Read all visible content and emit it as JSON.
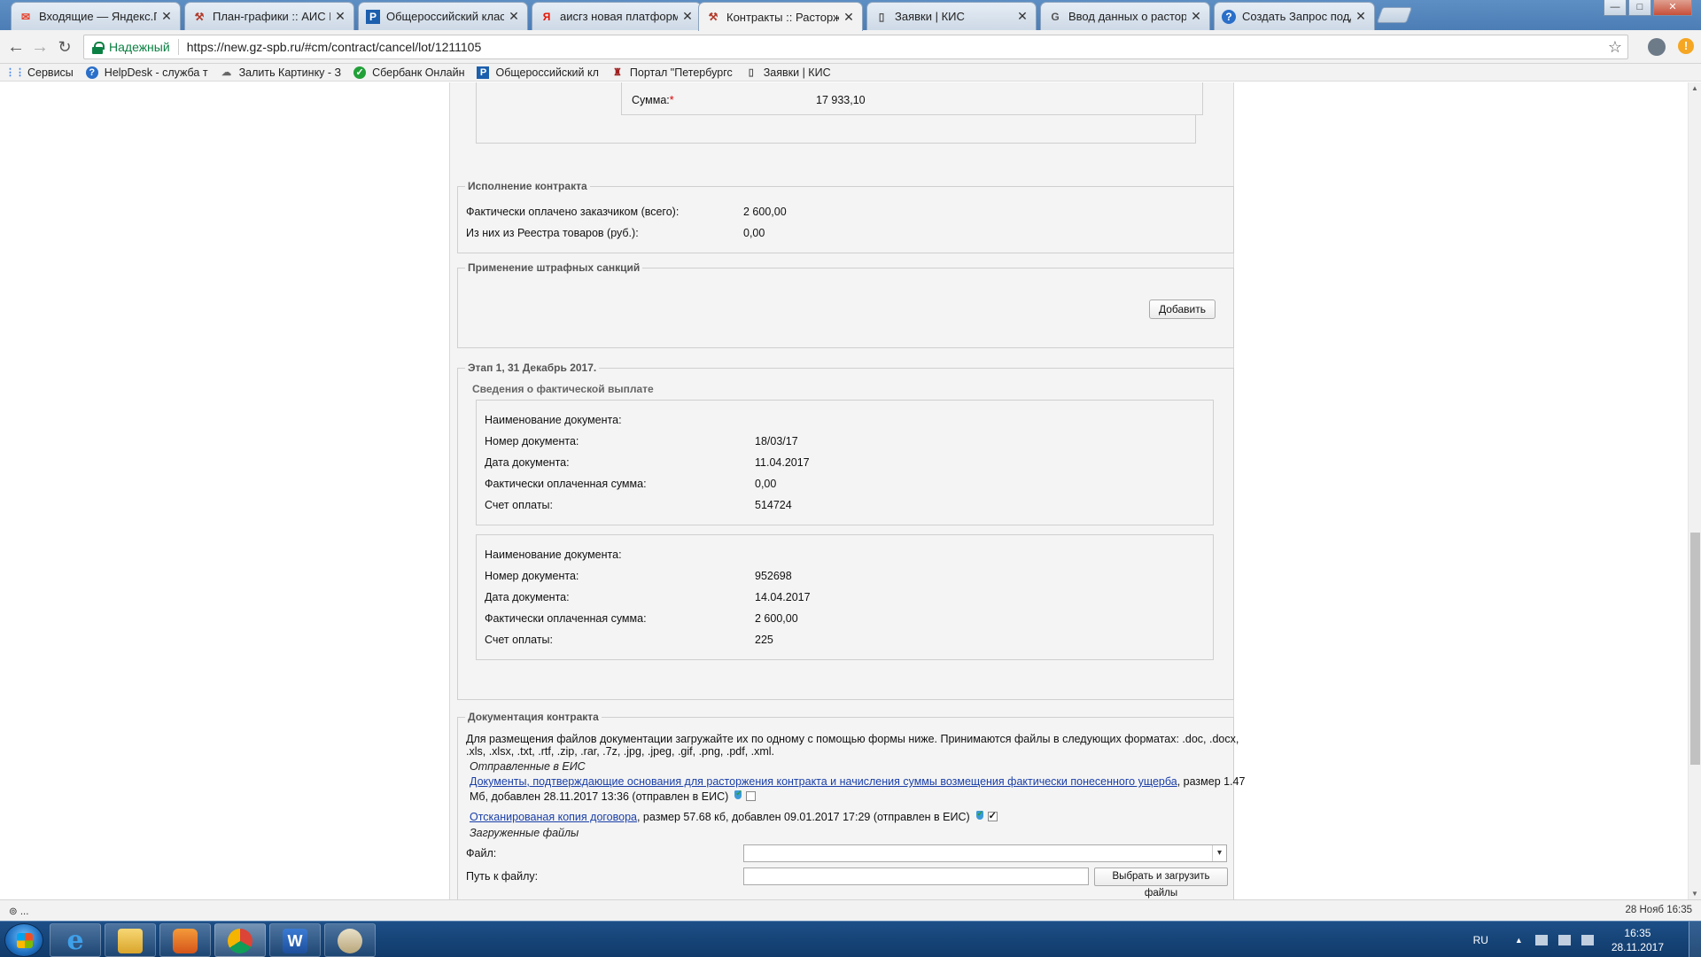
{
  "browser": {
    "tabs": [
      {
        "title": "Входящие — Яндекс.По",
        "icon": "mail-icon",
        "color": "#e8422c"
      },
      {
        "title": "План-графики :: АИС ГЗ",
        "icon": "hammer-icon",
        "color": "#b23a2a"
      },
      {
        "title": "Общероссийский класс",
        "icon": "okpd-icon",
        "color": "#1b5fad"
      },
      {
        "title": "аисгз новая платформа",
        "icon": "yandex-icon",
        "color": "#e61400"
      },
      {
        "title": "Контракты :: Расторжен",
        "icon": "hammer-icon",
        "color": "#b23a2a"
      },
      {
        "title": "Заявки | КИС",
        "icon": "document-icon",
        "color": "#555555"
      },
      {
        "title": "Ввод данных о расторж",
        "icon": "google-icon",
        "color": "#555555"
      },
      {
        "title": "Создать Запрос поддер",
        "icon": "helpdesk-icon",
        "color": "#2a6fc9"
      }
    ],
    "close_glyph": "✕",
    "secure_label": "Надежный",
    "url": "https://new.gz-spb.ru/#cm/contract/cancel/lot/1211105",
    "bookmarks": [
      {
        "label": "Сервисы",
        "icon": "apps-grid-icon"
      },
      {
        "label": "HelpDesk - служба т",
        "icon": "helpdesk-icon"
      },
      {
        "label": "Залить Картинку - З",
        "icon": "image-upload-icon"
      },
      {
        "label": "Сбербанк Онлайн",
        "icon": "sberbank-icon"
      },
      {
        "label": "Общероссийский кл",
        "icon": "okpd-icon"
      },
      {
        "label": "Портал \"Петербургс",
        "icon": "portal-icon"
      },
      {
        "label": "Заявки | КИС",
        "icon": "document-icon"
      }
    ]
  },
  "page": {
    "sum": {
      "label": "Сумма:",
      "required_mark": "*",
      "value": "17 933,10"
    },
    "execution": {
      "legend": "Исполнение контракта",
      "rows": [
        {
          "label": "Фактически оплачено заказчиком (всего):",
          "value": "2 600,00"
        },
        {
          "label": "Из них из Реестра товаров (руб.):",
          "value": "0,00"
        }
      ]
    },
    "penalties": {
      "legend": "Применение штрафных санкций",
      "add_button": "Добавить"
    },
    "stage": {
      "legend": "Этап 1, 31 Декабрь 2017.",
      "subtitle": "Сведения о фактической выплате",
      "payments": [
        {
          "rows": [
            {
              "label": "Наименование документа:",
              "value": ""
            },
            {
              "label": "Номер документа:",
              "value": "18/03/17"
            },
            {
              "label": "Дата документа:",
              "value": "11.04.2017"
            },
            {
              "label": "Фактически оплаченная сумма:",
              "value": "0,00"
            },
            {
              "label": "Счет оплаты:",
              "value": "514724"
            }
          ]
        },
        {
          "rows": [
            {
              "label": "Наименование документа:",
              "value": ""
            },
            {
              "label": "Номер документа:",
              "value": "952698"
            },
            {
              "label": "Дата документа:",
              "value": "14.04.2017"
            },
            {
              "label": "Фактически оплаченная сумма:",
              "value": "2 600,00"
            },
            {
              "label": "Счет оплаты:",
              "value": "225"
            }
          ]
        }
      ]
    },
    "docs": {
      "legend": "Документация контракта",
      "intro_line1": "Для размещения файлов документации загружайте их по одному с помощью формы ниже. Принимаются файлы в следующих форматах: .doc, .docx,",
      "intro_line2": ".xls, .xlsx, .txt, .rtf, .zip, .rar, .7z, .jpg, .jpeg, .gif, .png, .pdf, .xml.",
      "sent_heading": "Отправленные в ЕИС",
      "file1_link": "Документы, подтверждающие основания для расторжения контракта и начисления суммы возмещения фактически понесенного ущерба",
      "file1_meta_line1": ", размер 1.47",
      "file1_meta_line2": "Мб, добавлен 28.11.2017 13:36 (отправлен в ЕИС)",
      "file1_checked": false,
      "file2_link": "Отсканированая копия договора",
      "file2_meta": ", размер 57.68 кб, добавлен 09.01.2017 17:29 (отправлен в ЕИС)",
      "file2_checked": true,
      "uploaded_heading": "Загруженные файлы",
      "file_label": "Файл:",
      "path_label": "Путь к файлу:",
      "upload_button": "Выбрать и загрузить файлы"
    }
  },
  "statusbar": {
    "left": "⊚ ...",
    "right": "28 Нояб 16:35"
  },
  "taskbar": {
    "apps": [
      "internet-explorer-icon",
      "file-explorer-icon",
      "media-player-icon",
      "chrome-icon",
      "word-icon",
      "paint-icon"
    ],
    "lang": "RU",
    "time": "16:35",
    "date": "28.11.2017"
  }
}
